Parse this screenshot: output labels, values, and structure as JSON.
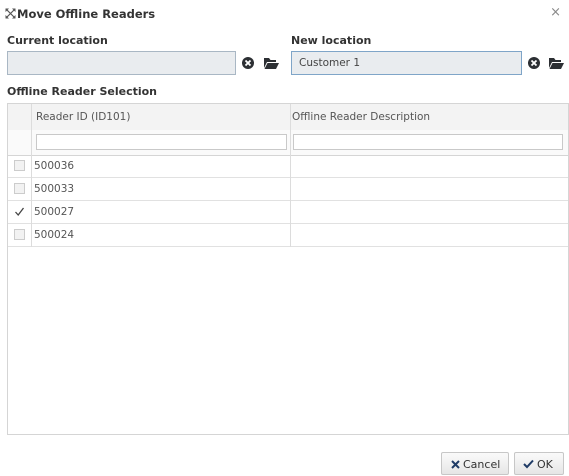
{
  "dialog": {
    "title": "Move Offline Readers"
  },
  "current_location": {
    "label": "Current location",
    "value": ""
  },
  "new_location": {
    "label": "New location",
    "value": "Customer 1"
  },
  "selection": {
    "label": "Offline Reader Selection",
    "columns": [
      "Reader ID (ID101)",
      "Offline Reader Description"
    ],
    "rows": [
      {
        "id": "500036",
        "description": "",
        "checked": false
      },
      {
        "id": "500033",
        "description": "",
        "checked": false
      },
      {
        "id": "500027",
        "description": "",
        "checked": true
      },
      {
        "id": "500024",
        "description": "",
        "checked": false
      }
    ]
  },
  "buttons": {
    "cancel": "Cancel",
    "ok": "OK"
  },
  "colors": {
    "icon": "#2c2f33",
    "check": "#444444",
    "cancel_icon": "#1f3b66",
    "ok_icon": "#1f3b66"
  }
}
